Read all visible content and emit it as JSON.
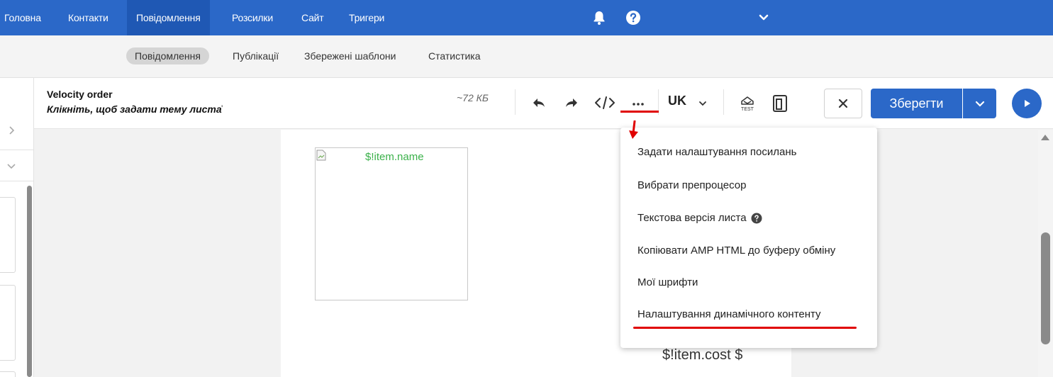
{
  "topnav": {
    "items": [
      {
        "label": "Головна",
        "active": false
      },
      {
        "label": "Контакти",
        "active": false
      },
      {
        "label": "Повідомлення",
        "active": true
      },
      {
        "label": "Розсилки",
        "active": false
      },
      {
        "label": "Сайт",
        "active": false
      },
      {
        "label": "Тригери",
        "active": false
      }
    ],
    "icons": [
      "bell-icon",
      "help-icon",
      "chevron-down-icon"
    ]
  },
  "subnav": {
    "tabs": [
      {
        "label": "Повідомлення",
        "active": true
      },
      {
        "label": "Публікації",
        "active": false
      },
      {
        "label": "Збережені шаблони",
        "active": false
      },
      {
        "label": "Статистика",
        "active": false
      }
    ]
  },
  "toolbar": {
    "title": "Velocity order",
    "subject_hint": "Клікніть, щоб задати тему листа",
    "size": "~72 КБ",
    "language": "UK",
    "save_label": "Зберегти",
    "icons": [
      "undo-icon",
      "redo-icon",
      "code-icon",
      "more-icon",
      "test-icon",
      "mobile-preview-icon",
      "close-icon",
      "chevron-down-icon",
      "play-icon"
    ]
  },
  "email": {
    "image_alt": "$!item.name",
    "item_cost": "$!item.cost $"
  },
  "menu": {
    "items": [
      {
        "label": "Задати налаштування посилань"
      },
      {
        "label": "Вибрати препроцесор"
      },
      {
        "label": "Текстова версія листа"
      },
      {
        "label": "Копіювати AMP HTML до буферу обміну"
      },
      {
        "label": "Мої шрифти"
      },
      {
        "label": "Налаштування динамічного контенту"
      }
    ]
  },
  "colors": {
    "brand_blue": "#2b68c8",
    "nav_active": "#1f58b4",
    "highlight_red": "#e00000",
    "alt_text_green": "#3bb14a"
  }
}
